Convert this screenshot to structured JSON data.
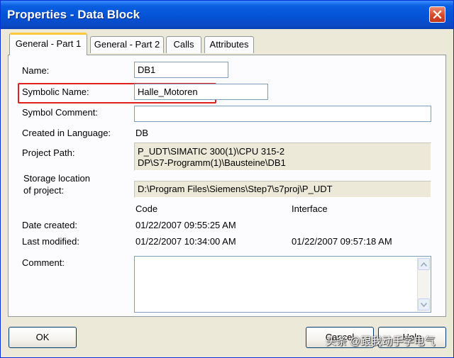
{
  "window": {
    "title": "Properties - Data Block"
  },
  "icons": {
    "close": "close-icon",
    "scroll_up": "arrow-up-icon",
    "scroll_down": "arrow-down-icon"
  },
  "tabs": [
    {
      "label": "General - Part 1",
      "active": true
    },
    {
      "label": "General - Part 2",
      "active": false
    },
    {
      "label": "Calls",
      "active": false
    },
    {
      "label": "Attributes",
      "active": false
    }
  ],
  "form": {
    "name_label": "Name:",
    "name_value": "DB1",
    "symbolic_name_label": "Symbolic Name:",
    "symbolic_name_value": "Halle_Motoren",
    "symbol_comment_label": "Symbol Comment:",
    "symbol_comment_value": "",
    "created_in_language_label": "Created in Language:",
    "created_in_language_value": "DB",
    "project_path_label": "Project Path:",
    "project_path_line1": "P_UDT\\SIMATIC 300(1)\\CPU 315-2",
    "project_path_line2": "DP\\S7-Programm(1)\\Bausteine\\DB1",
    "storage_label_line1": "Storage location",
    "storage_label_line2": "of project:",
    "storage_value": "D:\\Program Files\\Siemens\\Step7\\s7proj\\P_UDT",
    "col_code": "Code",
    "col_interface": "Interface",
    "date_created_label": "Date created:",
    "date_created_code": "01/22/2007 09:55:25 AM",
    "last_modified_label": "Last modified:",
    "last_modified_code": "01/22/2007 10:34:00 AM",
    "last_modified_interface": "01/22/2007 09:57:18 AM",
    "comment_label": "Comment:",
    "comment_value": ""
  },
  "buttons": {
    "ok": "OK",
    "cancel": "Cancel",
    "help": "Help"
  },
  "watermark": "头条 @跟我动手学电气",
  "colors": {
    "highlight_box": "#e0201a",
    "titlebar": "#0453d5",
    "active_tab_accent": "#ffc83c"
  }
}
